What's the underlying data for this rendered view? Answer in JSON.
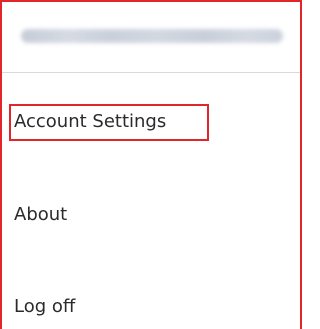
{
  "menu": {
    "items": [
      {
        "label": "Account Settings"
      },
      {
        "label": "About"
      },
      {
        "label": "Log off"
      }
    ]
  },
  "colors": {
    "highlight": "#e0252b",
    "text": "#2b2b2b",
    "divider": "#d9d9d9"
  }
}
